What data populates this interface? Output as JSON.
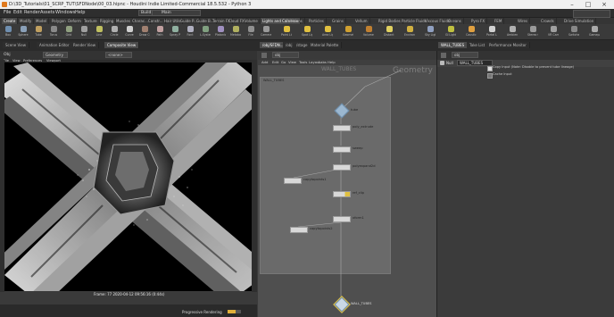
{
  "window": {
    "title": "D:\\3D_Tutorials\\01_SCRP_TUT\\SFDNode\\00_03.hipnc - Houdini Indie Limited-Commercial 18.5.532 - Python 3"
  },
  "menu": {
    "items": [
      "File",
      "Edit",
      "Render",
      "Assets",
      "Windows",
      "Help"
    ],
    "build_label": "Build",
    "main_label": "Main"
  },
  "left_shelf": {
    "tabs": [
      "Create",
      "Modify",
      "Model",
      "Polygon",
      "Deform",
      "Texture",
      "Rigging",
      "Muscles",
      "Charac...",
      "Constr...",
      "Hair Utils",
      "Guide P...",
      "Guide B...",
      "Terrain FX",
      "Cloud FX",
      "Volume"
    ],
    "tools": [
      "Box",
      "Sphere",
      "Tube",
      "Torus",
      "Grid",
      "Null",
      "Line",
      "Circle",
      "Curve",
      "Draw Curve",
      "Path",
      "Spray Paint",
      "Font",
      "L-System",
      "Platonic",
      "Metaball",
      "File"
    ]
  },
  "right_shelf": {
    "tabs": [
      "Lights and Cameras",
      "Collisions",
      "Particles",
      "Grains",
      "Vellum",
      "Rigid Bodies",
      "Particle Fluids",
      "Viscous Fluids",
      "Oceans",
      "Pyro FX",
      "FEM",
      "Wires",
      "Crowds",
      "Drive Simulation"
    ],
    "tools": [
      "Camera",
      "Point Light",
      "Spot Light",
      "Area Light",
      "Geometry Light",
      "Volume Light",
      "Distant Light",
      "Environment Light",
      "Sky Light",
      "GI Light",
      "Caustic Light",
      "Portal Light",
      "Ambient Light",
      "Stereo Camera",
      "VR Camera",
      "Switcher",
      "Gamepad Camera"
    ]
  },
  "left_tabs": [
    "Scene View",
    "Animation Editor",
    "Render View",
    "Composite View"
  ],
  "left_tabs_active": 3,
  "viewport": {
    "bar_items": [
      "Obj",
      "Geometry"
    ],
    "camera_label": "<none>",
    "menu_items": [
      "File",
      "View",
      "Preferences",
      "Viewport"
    ],
    "frame_info": "Frame: 77  2020-04-12  09:56:16 (0:44s)",
    "render_status": "Progressive Rendering",
    "progress": 0.6
  },
  "network": {
    "tabs": [
      "/obj/SFDN...",
      "/obj",
      "/stage",
      "Material Palette"
    ],
    "path": "obj",
    "menu_items": [
      "Add",
      "Edit",
      "Go",
      "View",
      "Tools",
      "Layout",
      "Labs",
      "Help"
    ],
    "context_label": "Geometry",
    "box_label": "WALL_TUBES",
    "nodes": [
      "tube",
      "poly_extrude",
      "sweep",
      "polyexpand2d",
      "copytopoints1",
      "ref_clip",
      "xform1",
      "copytopoints2",
      "WALL_TUBES"
    ]
  },
  "params": {
    "tabs": [
      "WALL_TUBES",
      "Take List",
      "Performance Monitor"
    ],
    "path": "obj",
    "node_type": "Null",
    "node_name": "WALL_TUBES",
    "checkboxes": [
      {
        "label": "Copy Input (Note: Disable to prevent tube lineage)",
        "on": true
      },
      {
        "label": "Cache Input",
        "on": false
      }
    ]
  }
}
